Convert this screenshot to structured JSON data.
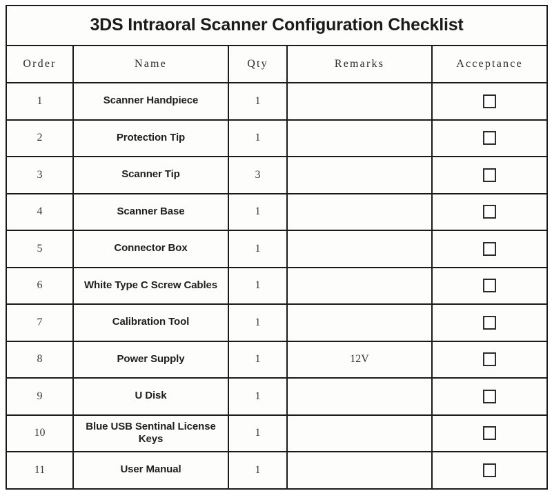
{
  "document": {
    "title": "3DS Intraoral Scanner Configuration Checklist"
  },
  "table": {
    "columns": [
      {
        "key": "order",
        "label": "Order"
      },
      {
        "key": "name",
        "label": "Name"
      },
      {
        "key": "qty",
        "label": "Qty"
      },
      {
        "key": "remarks",
        "label": "Remarks"
      },
      {
        "key": "acceptance",
        "label": "Acceptance"
      }
    ],
    "rows": [
      {
        "order": "1",
        "name": "Scanner Handpiece",
        "qty": "1",
        "remarks": "",
        "acceptance": "unchecked"
      },
      {
        "order": "2",
        "name": "Protection Tip",
        "qty": "1",
        "remarks": "",
        "acceptance": "unchecked"
      },
      {
        "order": "3",
        "name": "Scanner Tip",
        "qty": "3",
        "remarks": "",
        "acceptance": "unchecked"
      },
      {
        "order": "4",
        "name": "Scanner Base",
        "qty": "1",
        "remarks": "",
        "acceptance": "unchecked"
      },
      {
        "order": "5",
        "name": "Connector Box",
        "qty": "1",
        "remarks": "",
        "acceptance": "unchecked"
      },
      {
        "order": "6",
        "name": "White Type C Screw Cables",
        "qty": "1",
        "remarks": "",
        "acceptance": "unchecked"
      },
      {
        "order": "7",
        "name": "Calibration Tool",
        "qty": "1",
        "remarks": "",
        "acceptance": "unchecked"
      },
      {
        "order": "8",
        "name": "Power Supply",
        "qty": "1",
        "remarks": "12V",
        "acceptance": "unchecked"
      },
      {
        "order": "9",
        "name": "U Disk",
        "qty": "1",
        "remarks": "",
        "acceptance": "unchecked"
      },
      {
        "order": "10",
        "name": "Blue USB Sentinal License Keys",
        "qty": "1",
        "remarks": "",
        "acceptance": "unchecked"
      },
      {
        "order": "11",
        "name": "User Manual",
        "qty": "1",
        "remarks": "",
        "acceptance": "unchecked"
      }
    ]
  },
  "colors": {
    "border": "#1a1a1a",
    "text": "#1f1f1f",
    "muted_text": "#3a3a3a",
    "background": "#fdfdfb",
    "page_background": "#ffffff"
  }
}
